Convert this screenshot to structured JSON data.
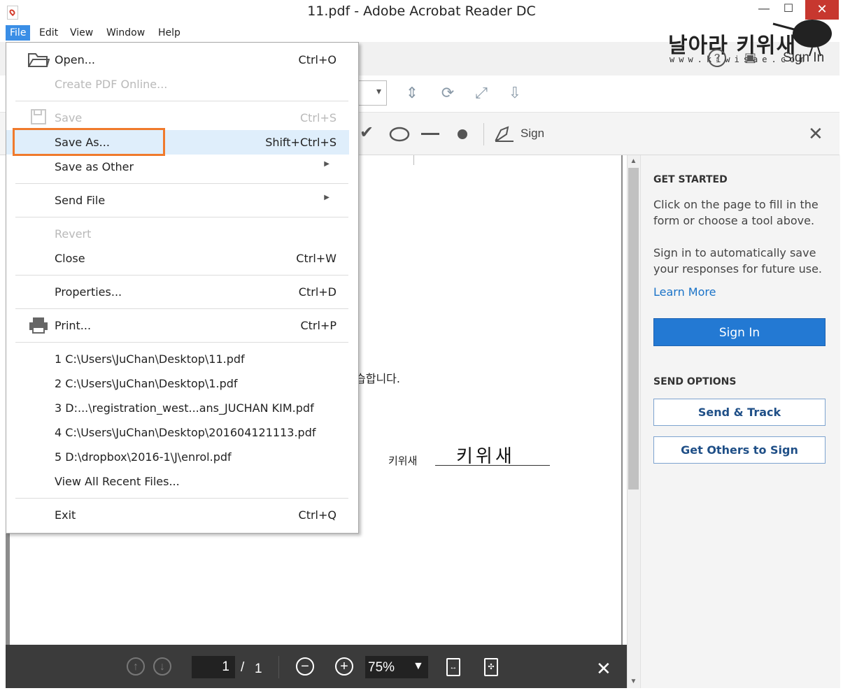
{
  "window": {
    "title": "11.pdf - Adobe Acrobat Reader DC",
    "min_icon": "minimize-icon",
    "max_icon": "maximize-icon",
    "close_icon": "close-icon"
  },
  "menubar": {
    "items": [
      "File",
      "Edit",
      "View",
      "Window",
      "Help"
    ]
  },
  "watermark": {
    "korean": "날아라 키위새",
    "url": "www.kiwisae.com"
  },
  "header": {
    "sign_in": "Sign In"
  },
  "fill_toolbar": {
    "sign_label": "Sign"
  },
  "file_menu": {
    "open": {
      "label": "Open...",
      "shortcut": "Ctrl+O"
    },
    "create_pdf": {
      "label": "Create PDF Online..."
    },
    "save": {
      "label": "Save",
      "shortcut": "Ctrl+S"
    },
    "save_as": {
      "label": "Save As...",
      "shortcut": "Shift+Ctrl+S"
    },
    "save_as_other": {
      "label": "Save as Other"
    },
    "send_file": {
      "label": "Send File"
    },
    "revert": {
      "label": "Revert"
    },
    "close": {
      "label": "Close",
      "shortcut": "Ctrl+W"
    },
    "properties": {
      "label": "Properties...",
      "shortcut": "Ctrl+D"
    },
    "print": {
      "label": "Print...",
      "shortcut": "Ctrl+P"
    },
    "recent": [
      "1 C:\\Users\\JuChan\\Desktop\\11.pdf",
      "2 C:\\Users\\JuChan\\Desktop\\1.pdf",
      "3 D:...\\registration_west...ans_JUCHAN KIM.pdf",
      "4 C:\\Users\\JuChan\\Desktop\\201604121113.pdf",
      "5 D:\\dropbox\\2016-1\\J\\enrol.pdf"
    ],
    "view_all_recent": {
      "label": "View All Recent Files..."
    },
    "exit": {
      "label": "Exit",
      "shortcut": "Ctrl+Q"
    }
  },
  "document": {
    "text_fragment": "습합니다.",
    "signature_label": "키위새",
    "signature_handwritten": "키위새"
  },
  "bottom_bar": {
    "page_current": "1",
    "page_sep": "/",
    "page_total": "1",
    "zoom": "75%"
  },
  "right_pane": {
    "get_started_heading": "GET STARTED",
    "get_started_text1": "Click on the page to fill in the form or choose a tool above.",
    "get_started_text2": "Sign in to automatically save your responses for future use.",
    "learn_more": "Learn More",
    "sign_in_button": "Sign In",
    "send_options_heading": "SEND OPTIONS",
    "send_track_button": "Send & Track",
    "get_others_button": "Get Others to Sign"
  },
  "colors": {
    "accent": "#2379d3",
    "highlight_border": "#f07a2c",
    "bottom_bar": "#3b3b3b"
  }
}
